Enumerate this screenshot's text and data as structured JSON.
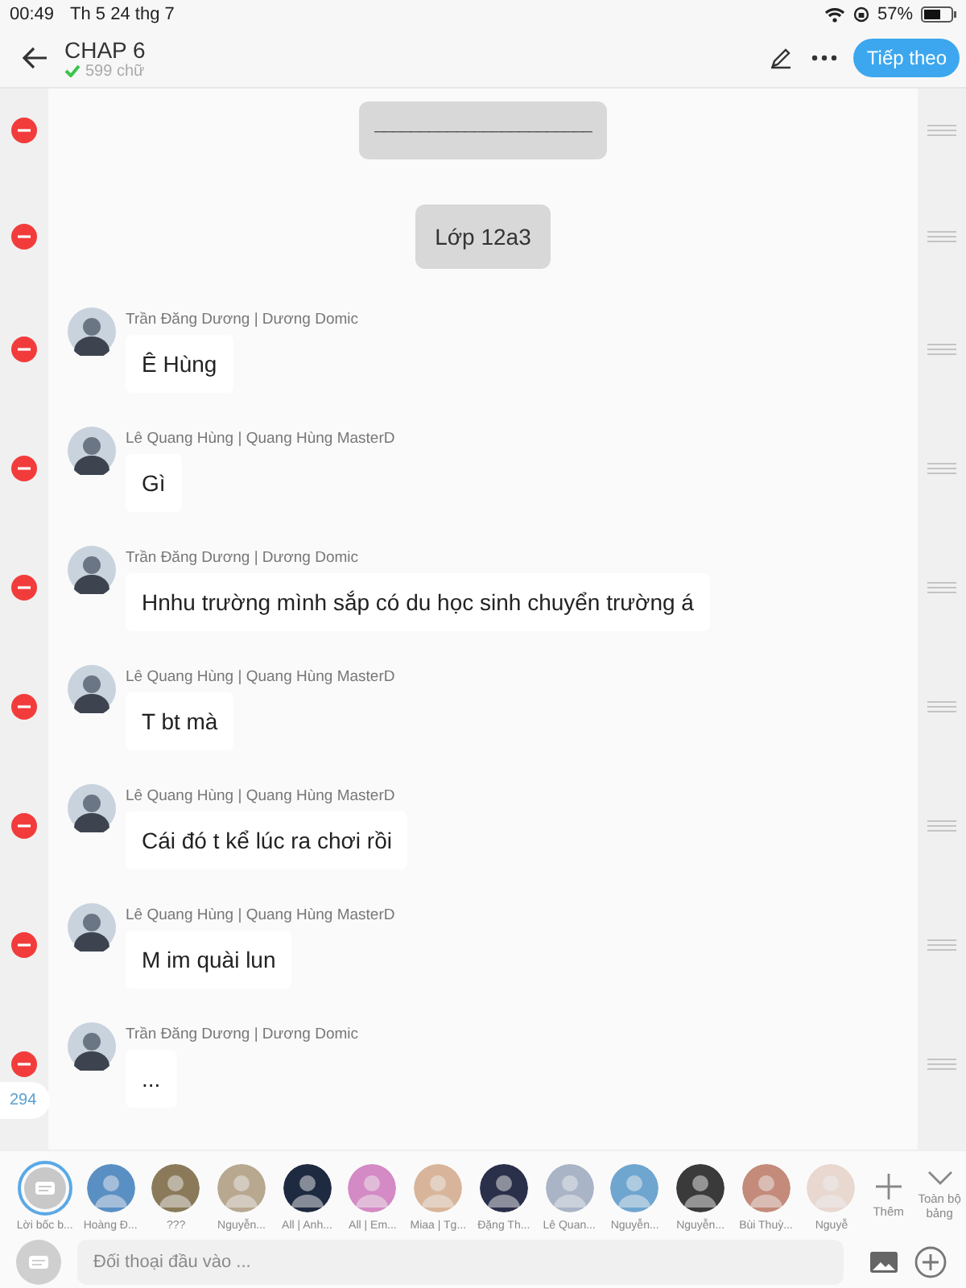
{
  "status_bar": {
    "time": "00:49",
    "date": "Th 5 24 thg 7",
    "battery": "57%"
  },
  "header": {
    "title": "CHAP 6",
    "word_count": "599 chữ",
    "next_button": "Tiếp theo"
  },
  "entries": [
    {
      "kind": "narration",
      "text": "________________________"
    },
    {
      "kind": "narration",
      "text": "Lớp 12a3"
    },
    {
      "kind": "message",
      "speaker": "Trần Đăng Dương | Dương Domic",
      "text": "Ê Hùng"
    },
    {
      "kind": "message",
      "speaker": "Lê Quang Hùng | Quang Hùng MasterD",
      "text": "Gì"
    },
    {
      "kind": "message",
      "speaker": "Trần Đăng Dương | Dương Domic",
      "text": "Hnhu trường mình sắp có du học sinh chuyển trường á"
    },
    {
      "kind": "message",
      "speaker": "Lê Quang Hùng | Quang Hùng MasterD",
      "text": "T bt mà"
    },
    {
      "kind": "message",
      "speaker": "Lê Quang Hùng | Quang Hùng MasterD",
      "text": "Cái đó t kể lúc ra chơi rồi"
    },
    {
      "kind": "message",
      "speaker": "Lê Quang Hùng | Quang Hùng MasterD",
      "text": "M im quài lun"
    },
    {
      "kind": "message",
      "speaker": "Trần Đăng Dương | Dương Domic",
      "text": "..."
    }
  ],
  "entry_count": "294",
  "characters": [
    {
      "kind": "narration",
      "label": "Lời bốc b...",
      "selected": true
    },
    {
      "kind": "avatar",
      "label": "Hoàng Đ...",
      "selected": false
    },
    {
      "kind": "avatar",
      "label": "???",
      "selected": false
    },
    {
      "kind": "avatar",
      "label": "Nguyễn...",
      "selected": false
    },
    {
      "kind": "avatar",
      "label": "All | Anh...",
      "selected": false
    },
    {
      "kind": "avatar",
      "label": "All | Em...",
      "selected": false
    },
    {
      "kind": "avatar",
      "label": "Miaa | Tg...",
      "selected": false
    },
    {
      "kind": "avatar",
      "label": "Đặng Th...",
      "selected": false
    },
    {
      "kind": "avatar",
      "label": "Lê Quan...",
      "selected": false
    },
    {
      "kind": "avatar",
      "label": "Nguyễn...",
      "selected": false
    },
    {
      "kind": "avatar",
      "label": "Nguyễn...",
      "selected": false
    },
    {
      "kind": "avatar",
      "label": "Bùi Thuỳ...",
      "selected": false
    },
    {
      "kind": "avatar",
      "label": "Nguyễ",
      "selected": false
    }
  ],
  "add_label": "Thêm",
  "collapse_label": "Toàn bộ bảng",
  "input": {
    "placeholder": "Đối thoại đầu vào ..."
  }
}
